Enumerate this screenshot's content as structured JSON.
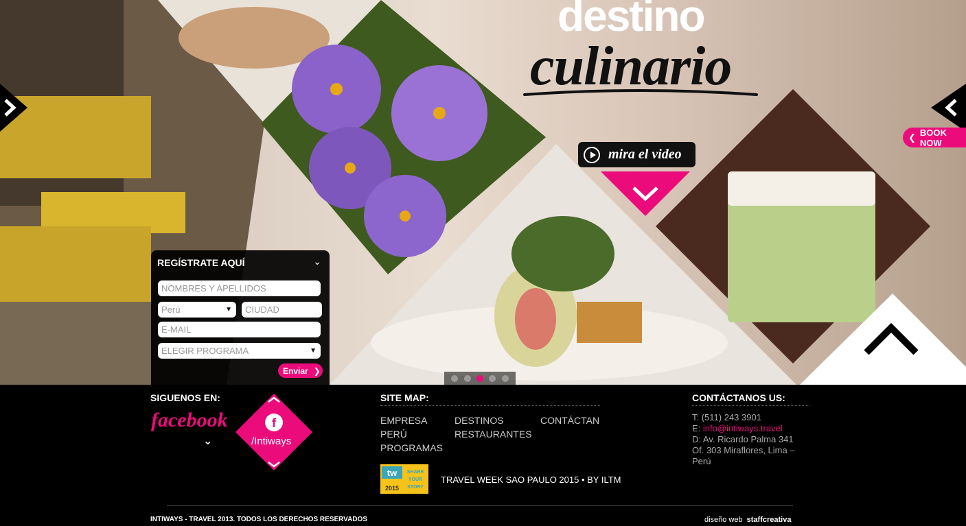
{
  "hero": {
    "title_line1": "destino",
    "title_line2": "culinario",
    "video_label": "mira el video",
    "book_now": "BOOK NOW",
    "slides": [
      {
        "active": false
      },
      {
        "active": false
      },
      {
        "active": true
      },
      {
        "active": false
      },
      {
        "active": false
      }
    ]
  },
  "register": {
    "title": "REGÍSTRATE AQUÍ",
    "name_placeholder": "NOMBRES Y APELLIDOS",
    "country_value": "Perú",
    "city_placeholder": "CIUDAD",
    "email_placeholder": "E-MAIL",
    "program_placeholder": "ELEGIR PROGRAMA",
    "submit_label": "Enviar"
  },
  "social": {
    "heading": "SIGUENOS EN:",
    "facebook_word": "facebook",
    "handle": "/Intiways"
  },
  "sitemap": {
    "heading": "SITE MAP:",
    "links": [
      [
        "EMPRESA",
        "DESTINOS",
        "CONTÁCTANOS"
      ],
      [
        "PERÚ",
        "RESTAURANTES",
        ""
      ],
      [
        "PROGRAMAS",
        "",
        ""
      ]
    ]
  },
  "contact": {
    "heading": "CONTÁCTANOS US:",
    "phone": "T: (511) 243 3901",
    "email_prefix": "E: ",
    "email": "info@intiways.travel",
    "address_1": "D: Av. Ricardo Palma 341",
    "address_2": "Of. 303 Miraflores, Lima –",
    "address_3": "Perú"
  },
  "promo": {
    "logo_text": "tw",
    "text": "TRAVEL WEEK SAO PAULO 2015 • BY ILTM"
  },
  "legal": {
    "copyright": "INTIWAYS - TRAVEL 2013. TODOS LOS DERECHOS RESERVADOS",
    "credit_prefix": "diseño web",
    "credit_brand": "staffcreativa"
  },
  "colors": {
    "accent": "#ec0b7b",
    "footer_bg": "#000000"
  }
}
